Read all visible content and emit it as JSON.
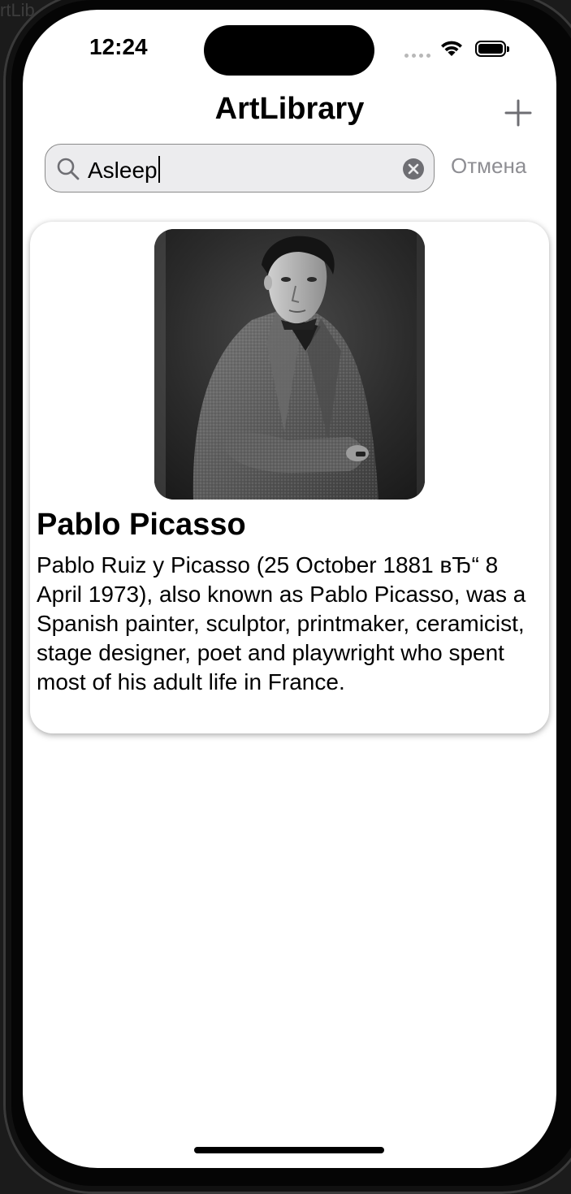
{
  "backdrop": {
    "text": "rtLib"
  },
  "status_bar": {
    "time": "12:24",
    "icons": [
      "signal-dots-icon",
      "wifi-icon",
      "battery-icon"
    ]
  },
  "nav": {
    "title": "ArtLibrary",
    "add_icon": "plus-icon"
  },
  "search": {
    "value": "Asleep",
    "search_icon": "search-icon",
    "clear_icon": "clear-circle-icon",
    "cancel_label": "Отмена"
  },
  "results": [
    {
      "name": "Pablo Picasso",
      "description": "Pablo Ruiz y Picasso (25 October 1881 вЂ“ 8 April 1973), also known as Pablo Picasso, was a Spanish painter, sculptor, printmaker, ceramicist, stage designer, poet and playwright who spent most of his adult life in France."
    }
  ],
  "colors": {
    "background": "#ffffff",
    "search_field": "#ececee",
    "cancel_text": "#8e8e93",
    "title_text": "#000000"
  }
}
